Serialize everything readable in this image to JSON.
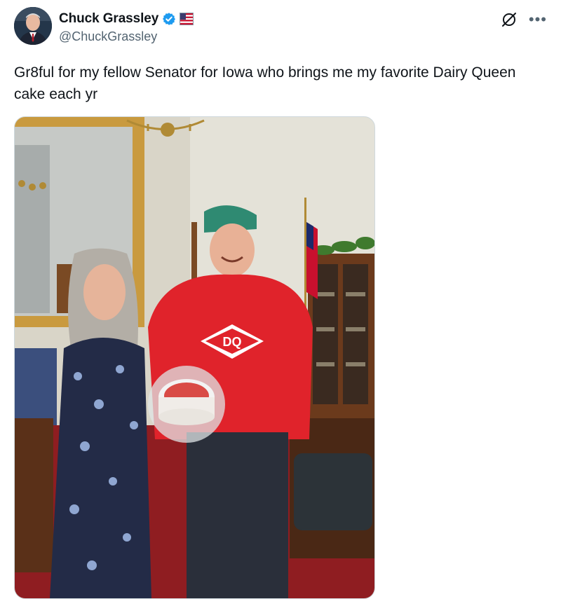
{
  "author": {
    "display_name": "Chuck Grassley",
    "handle": "@ChuckGrassley",
    "verified": true
  },
  "tweet": {
    "text": "Gr8ful for my fellow Senator for Iowa who brings me my favorite Dairy Queen cake each yr"
  },
  "icons": {
    "verified": "verified-badge-icon",
    "flag": "us-flag-icon",
    "grok": "grok-icon",
    "more": "more-options-icon"
  },
  "media": {
    "sweatshirt_logo": "DQ"
  },
  "colors": {
    "verified_blue": "#1d9bf0",
    "text_primary": "#0f1419",
    "text_secondary": "#536471",
    "sweatshirt_red": "#e0232b",
    "cap_green": "#2f8a72"
  }
}
